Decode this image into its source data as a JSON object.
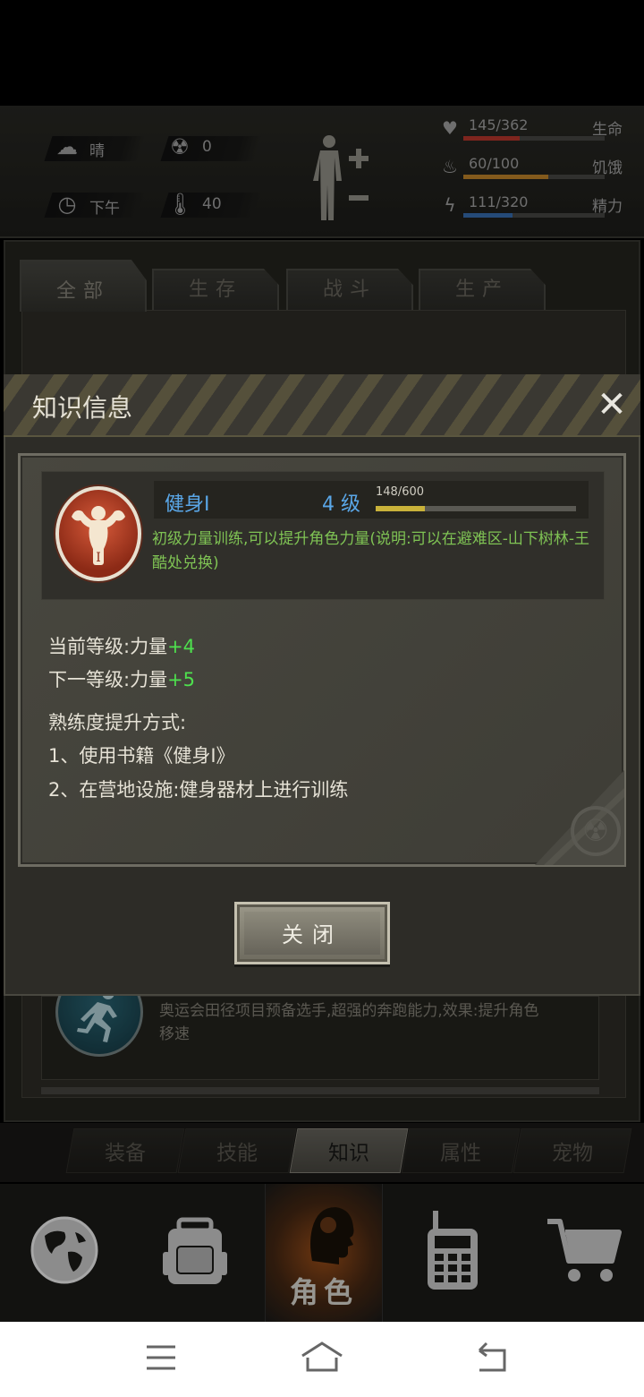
{
  "stats": {
    "weather": "晴",
    "radiation": "0",
    "time_of_day": "下午",
    "temperature": "40"
  },
  "vitals": [
    {
      "value": "145/362",
      "label": "生命",
      "current": 145,
      "max": 362,
      "color": "#c23a2e"
    },
    {
      "value": "60/100",
      "label": "饥饿",
      "current": 60,
      "max": 100,
      "color": "#c98a2c"
    },
    {
      "value": "111/320",
      "label": "精力",
      "current": 111,
      "max": 320,
      "color": "#3a72b8"
    }
  ],
  "category_tabs": [
    "全部",
    "生存",
    "战斗",
    "生产"
  ],
  "list": {
    "visible_item_desc": "奥运会田径项目预备选手,超强的奔跑能力,效果:提升角色移速"
  },
  "sub_tabs": [
    "装备",
    "技能",
    "知识",
    "属性",
    "宠物"
  ],
  "sub_tab_active": "知识",
  "main_nav": {
    "items": [
      "globe-icon",
      "backpack-icon",
      "character-icon",
      "radio-icon",
      "cart-icon"
    ],
    "active_label": "角色"
  },
  "dialog": {
    "title": "知识信息",
    "skill": {
      "name": "健身Ⅰ",
      "level": "4 级",
      "xp_text": "148/600",
      "xp_current": 148,
      "xp_max": 600,
      "description": "初级力量训练,可以提升角色力量(说明:可以在避难区-山下树林-王酷处兑换)"
    },
    "current_level_label": "当前等级:力量",
    "current_level_bonus": "+4",
    "next_level_label": "下一等级:力量",
    "next_level_bonus": "+5",
    "method_title": "熟练度提升方式:",
    "methods": [
      "1、使用书籍《健身Ⅰ》",
      "2、在营地设施:健身器材上进行训练"
    ],
    "close_button": "关闭"
  }
}
